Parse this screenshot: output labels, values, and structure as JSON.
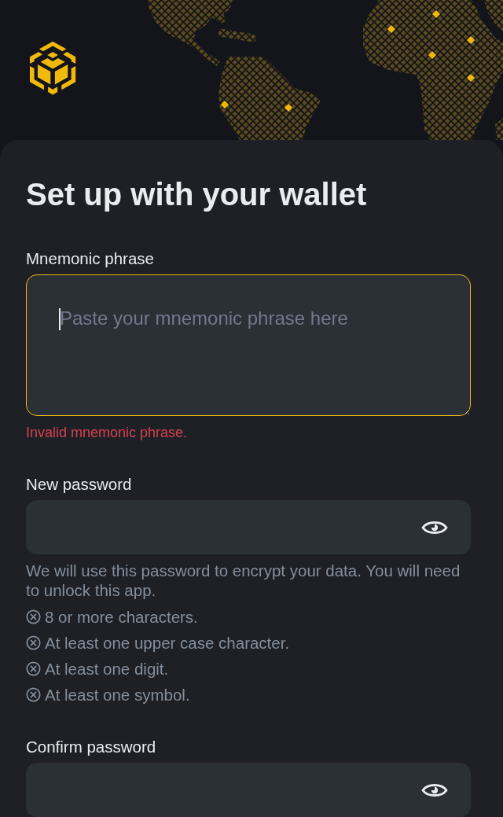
{
  "heading": "Set up with your wallet",
  "mnemonic": {
    "label": "Mnemonic phrase",
    "placeholder": "Paste your mnemonic phrase here",
    "focused": true,
    "error": "Invalid mnemonic phrase."
  },
  "new_password": {
    "label": "New password",
    "hint": "We will use this password to encrypt your data. You will need to unlock this app.",
    "requirements": [
      {
        "text": "8 or more characters.",
        "met": false
      },
      {
        "text": "At least one upper case character.",
        "met": false
      },
      {
        "text": "At least one digit.",
        "met": false
      },
      {
        "text": "At least one symbol.",
        "met": false
      }
    ]
  },
  "confirm_password": {
    "label": "Confirm password"
  }
}
